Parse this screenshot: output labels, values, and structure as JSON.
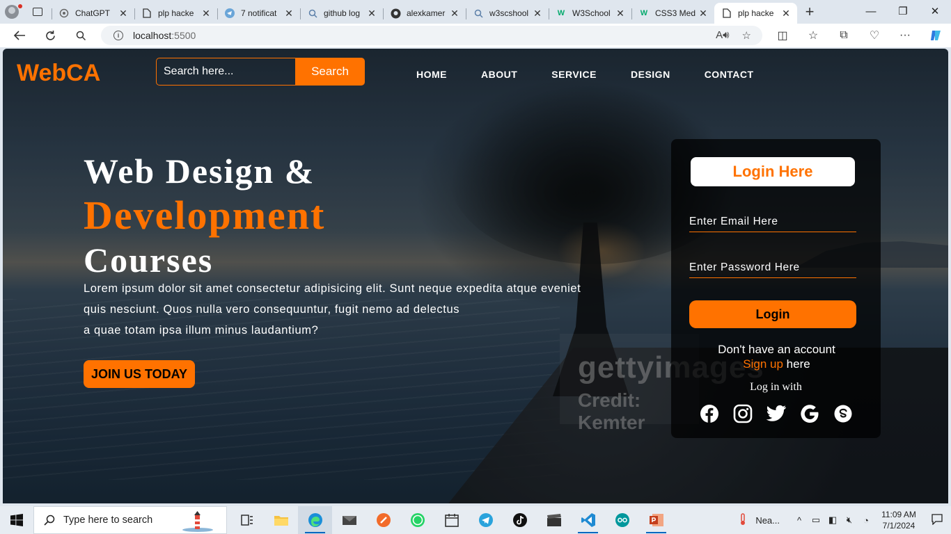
{
  "browser": {
    "tabs": [
      {
        "label": "ChatGPT",
        "icon": "chatgpt-icon"
      },
      {
        "label": "plp hacke",
        "icon": "page-icon"
      },
      {
        "label": "7 notificat",
        "icon": "telegram-icon"
      },
      {
        "label": "github log",
        "icon": "search-icon"
      },
      {
        "label": "alexkamer",
        "icon": "github-icon"
      },
      {
        "label": "w3scshool",
        "icon": "search-icon"
      },
      {
        "label": "W3School",
        "icon": "w3schools-icon"
      },
      {
        "label": "CSS3 Med",
        "icon": "w3schools-icon"
      },
      {
        "label": "plp hacke",
        "icon": "page-icon",
        "active": true
      }
    ],
    "close_glyph": "✕",
    "address": {
      "host": "localhost",
      "port": ":5500"
    },
    "controls": {
      "minimize": "—",
      "restore": "❐",
      "close": "✕",
      "new_tab": "+"
    }
  },
  "site": {
    "logo": "WebCA",
    "search": {
      "placeholder": "Search here...",
      "button": "Search"
    },
    "nav": [
      "HOME",
      "ABOUT",
      "SERVICE",
      "DESIGN",
      "CONTACT"
    ],
    "hero": {
      "line1": "Web Design &",
      "line2": "Development",
      "line3": "Courses",
      "para1": "Lorem ipsum dolor sit amet consectetur adipisicing elit. Sunt neque expedita atque eveniet",
      "para2": "quis nesciunt. Quos nulla vero consequuntur, fugit nemo ad delectus",
      "para3": "a quae totam ipsa illum minus laudantium?",
      "cta": "JOIN US TODAY"
    },
    "watermark": {
      "line1": "gettyimages",
      "line2": "Credit: Kemter"
    },
    "login": {
      "title": "Login Here",
      "email_placeholder": "Enter Email Here",
      "password_placeholder": "Enter Password Here",
      "button": "Login",
      "no_account": "Don't have an account",
      "signup_link": "Sign up",
      "signup_suffix": " here",
      "log_in_with": "Log in with",
      "socials": [
        "facebook-icon",
        "instagram-icon",
        "twitter-icon",
        "google-icon",
        "skype-icon"
      ]
    },
    "colors": {
      "accent": "#ff7200",
      "white": "#ffffff",
      "panel": "#000000"
    }
  },
  "taskbar": {
    "search_placeholder": "Type here to search",
    "weather": "Nea...",
    "time": "11:09 AM",
    "date": "7/1/2024",
    "apps": [
      "task-view-icon",
      "file-explorer-icon",
      "edge-icon",
      "mail-icon",
      "app-orange-icon",
      "whatsapp-icon",
      "calendar-icon",
      "telegram-icon",
      "tiktok-icon",
      "clapper-icon",
      "vscode-icon",
      "arduino-icon",
      "powerpoint-icon"
    ]
  }
}
